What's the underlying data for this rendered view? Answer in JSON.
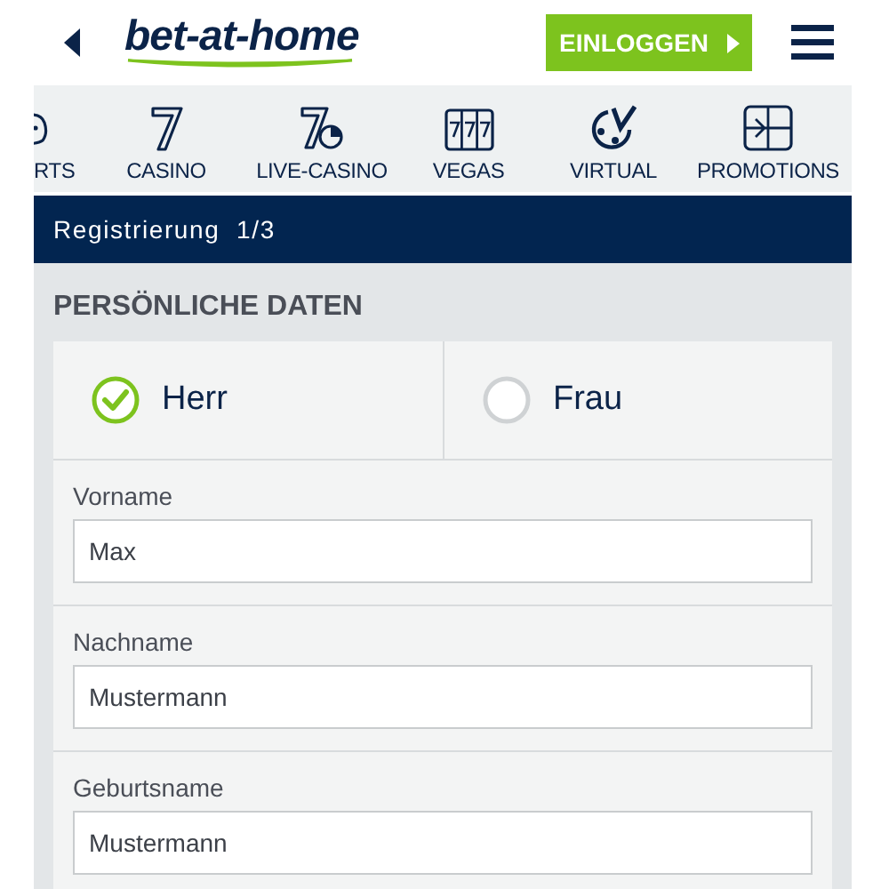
{
  "header": {
    "logo": "bet-at-home",
    "login_button": "EINLOGGEN"
  },
  "nav": [
    {
      "label": "RTS",
      "kind": "sports"
    },
    {
      "label": "CASINO",
      "kind": "casino"
    },
    {
      "label": "LIVE-CASINO",
      "kind": "live-casino"
    },
    {
      "label": "VEGAS",
      "kind": "vegas"
    },
    {
      "label": "VIRTUAL",
      "kind": "virtual"
    },
    {
      "label": "PROMOTIONS",
      "kind": "promotions"
    }
  ],
  "step": "Registrierung  1/3",
  "section": {
    "title": "PERSÖNLICHE DATEN",
    "salutations": [
      {
        "label": "Herr",
        "selected": true
      },
      {
        "label": "Frau",
        "selected": false
      }
    ],
    "fields": [
      {
        "label": "Vorname",
        "value": "Max"
      },
      {
        "label": "Nachname",
        "value": "Mustermann"
      },
      {
        "label": "Geburtsname",
        "value": "Mustermann"
      }
    ]
  }
}
